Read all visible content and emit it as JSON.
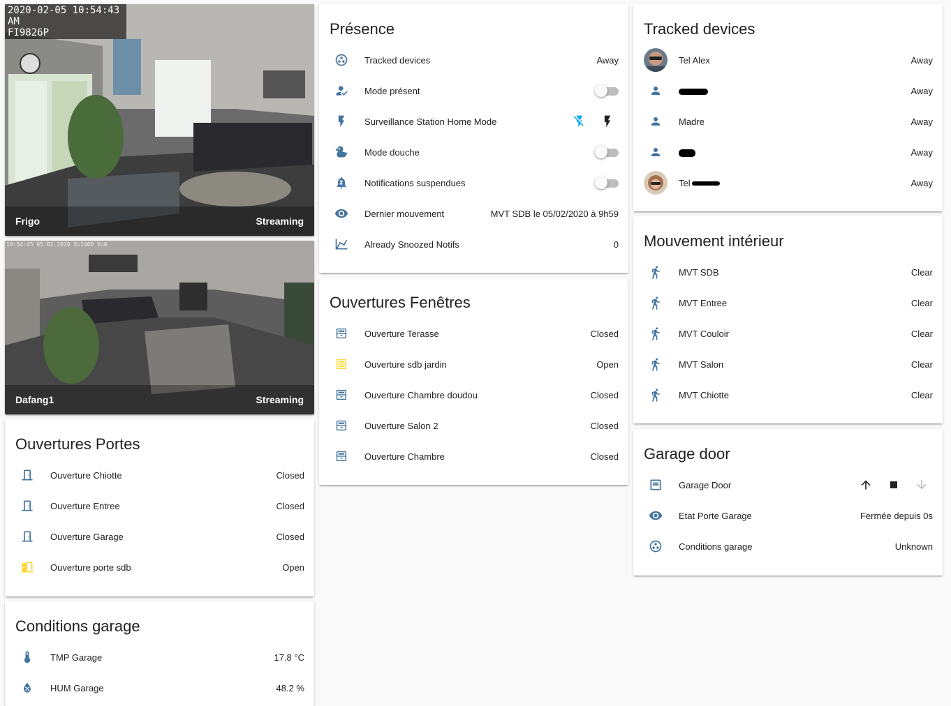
{
  "colors": {
    "icon": "#44739e",
    "icon_active": "#fdd835",
    "accent": "#03a9f4",
    "toggle_off": "#bdbdbd"
  },
  "cameras": [
    {
      "osd_line1": "2020-02-05 10:54:43 AM",
      "osd_line2": "FI9826P",
      "name": "Frigo",
      "state": "Streaming"
    },
    {
      "osd_line1": "10:54:45 05.02.2020 X=1400 V=0",
      "name": "Dafang1",
      "state": "Streaming"
    }
  ],
  "presence": {
    "title": "Présence",
    "rows": [
      {
        "icon": "google-circles-icon",
        "name": "Tracked devices",
        "state": "Away"
      },
      {
        "icon": "account-check-icon",
        "name": "Mode présent",
        "toggle": false
      },
      {
        "icon": "flash-icon",
        "name": "Surveillance Station Home Mode",
        "buttons": [
          "flash-off-icon",
          "flash-on-icon"
        ]
      },
      {
        "icon": "duck-icon",
        "name": "Mode douche",
        "toggle": false
      },
      {
        "icon": "bell-sleep-icon",
        "name": "Notifications suspendues",
        "toggle": false
      },
      {
        "icon": "eye-icon",
        "name": "Dernier mouvement",
        "state": "MVT SDB le 05/02/2020 à 9h59"
      },
      {
        "icon": "chart-line-icon",
        "name": "Already Snoozed Notifs",
        "state": "0"
      }
    ]
  },
  "fenetres": {
    "title": "Ouvertures Fenêtres",
    "rows": [
      {
        "name": "Ouverture Terasse",
        "state": "Closed",
        "active": false
      },
      {
        "name": "Ouverture sdb jardin",
        "state": "Open",
        "active": true
      },
      {
        "name": "Ouverture Chambre doudou",
        "state": "Closed",
        "active": false
      },
      {
        "name": "Ouverture Salon 2",
        "state": "Closed",
        "active": false
      },
      {
        "name": "Ouverture Chambre",
        "state": "Closed",
        "active": false
      }
    ]
  },
  "portes": {
    "title": "Ouvertures Portes",
    "rows": [
      {
        "name": "Ouverture Chiotte",
        "state": "Closed",
        "active": false
      },
      {
        "name": "Ouverture Entree",
        "state": "Closed",
        "active": false
      },
      {
        "name": "Ouverture Garage",
        "state": "Closed",
        "active": false
      },
      {
        "name": "Ouverture porte sdb",
        "state": "Open",
        "active": true
      }
    ]
  },
  "conditions": {
    "title": "Conditions garage",
    "rows": [
      {
        "icon": "thermometer-icon",
        "name": "TMP Garage",
        "state": "17.8 °C"
      },
      {
        "icon": "water-percent-icon",
        "name": "HUM Garage",
        "state": "48.2 %"
      }
    ]
  },
  "tracked": {
    "title": "Tracked devices",
    "rows": [
      {
        "avatar": "photo",
        "name": "Tel Alex",
        "state": "Away"
      },
      {
        "avatar": "person",
        "name": "",
        "redacted": true,
        "state": "Away"
      },
      {
        "avatar": "person",
        "name": "Madre",
        "state": "Away"
      },
      {
        "avatar": "person",
        "name": "",
        "redacted": true,
        "state": "Away"
      },
      {
        "avatar": "photo2",
        "name": "Tel",
        "redacted": true,
        "state": "Away"
      }
    ]
  },
  "mouvement": {
    "title": "Mouvement intérieur",
    "rows": [
      {
        "name": "MVT SDB",
        "state": "Clear"
      },
      {
        "name": "MVT Entree",
        "state": "Clear"
      },
      {
        "name": "MVT Couloir",
        "state": "Clear"
      },
      {
        "name": "MVT Salon",
        "state": "Clear"
      },
      {
        "name": "MVT Chiotte",
        "state": "Clear"
      }
    ]
  },
  "garage": {
    "title": "Garage door",
    "rows": [
      {
        "icon": "garage-icon",
        "name": "Garage Door",
        "buttons": [
          "arrow-up-icon",
          "stop-icon",
          "arrow-down-icon"
        ]
      },
      {
        "icon": "eye-icon",
        "name": "Etat Porte Garage",
        "state": "Fermée depuis 0s"
      },
      {
        "icon": "google-circles-icon",
        "name": "Conditions garage",
        "state": "Unknown"
      }
    ]
  }
}
